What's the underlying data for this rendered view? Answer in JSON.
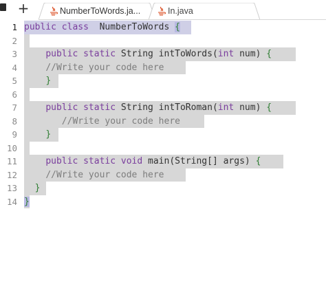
{
  "tabs": [
    {
      "label": "NumberToWords.ja...",
      "icon": "java-file-icon",
      "active": true
    },
    {
      "label": "In.java",
      "icon": "java-file-icon",
      "active": false
    }
  ],
  "new_tab_label": "+",
  "colors": {
    "keyword": "#7a3e9d",
    "comment": "#7d7d7d",
    "brace": "#2e7d32",
    "selection": "#d7d7d7"
  },
  "editor": {
    "lines": [
      {
        "n": "1",
        "segs": [
          [
            "kw",
            "public class"
          ],
          [
            "",
            "  NumberToWords "
          ],
          [
            "bm",
            "{"
          ]
        ]
      },
      {
        "n": "2",
        "segs": []
      },
      {
        "n": "3",
        "segs": [
          [
            "",
            "    "
          ],
          [
            "kw",
            "public static"
          ],
          [
            "",
            " String intToWords("
          ],
          [
            "kw",
            "int"
          ],
          [
            "",
            " num) "
          ],
          [
            "b",
            "{"
          ]
        ]
      },
      {
        "n": "4",
        "segs": [
          [
            "",
            "    "
          ],
          [
            "c",
            "//Write your code here"
          ]
        ]
      },
      {
        "n": "5",
        "segs": [
          [
            "",
            "    "
          ],
          [
            "b",
            "}"
          ]
        ]
      },
      {
        "n": "6",
        "segs": []
      },
      {
        "n": "7",
        "segs": [
          [
            "",
            "    "
          ],
          [
            "kw",
            "public static"
          ],
          [
            "",
            " String intToRoman("
          ],
          [
            "kw",
            "int"
          ],
          [
            "",
            " num) "
          ],
          [
            "b",
            "{"
          ]
        ]
      },
      {
        "n": "8",
        "segs": [
          [
            "",
            "       "
          ],
          [
            "c",
            "//Write your code here"
          ]
        ]
      },
      {
        "n": "9",
        "segs": [
          [
            "",
            "    "
          ],
          [
            "b",
            "}"
          ]
        ]
      },
      {
        "n": "10",
        "segs": []
      },
      {
        "n": "11",
        "segs": [
          [
            "",
            "    "
          ],
          [
            "kw",
            "public static void"
          ],
          [
            "",
            " main(String[] args) "
          ],
          [
            "b",
            "{"
          ]
        ]
      },
      {
        "n": "12",
        "segs": [
          [
            "",
            "    "
          ],
          [
            "c",
            "//Write your code here"
          ]
        ]
      },
      {
        "n": "13",
        "segs": [
          [
            "",
            "  "
          ],
          [
            "b",
            "}"
          ]
        ]
      },
      {
        "n": "14",
        "segs": [
          [
            "bm",
            "}"
          ]
        ]
      }
    ]
  }
}
